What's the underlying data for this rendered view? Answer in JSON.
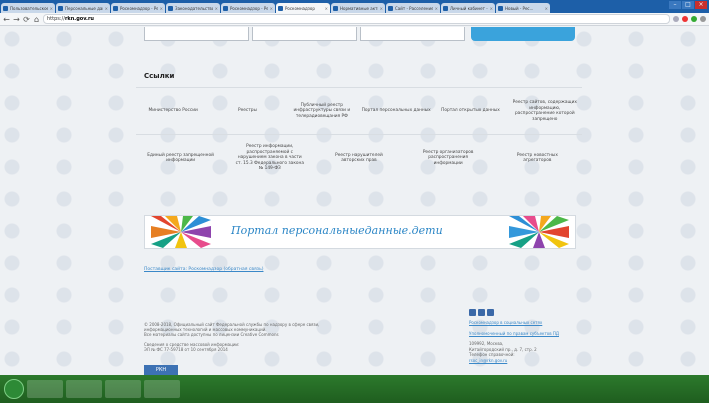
{
  "browser": {
    "tabs": [
      {
        "title": "Пользовательское согл..."
      },
      {
        "title": "Персональные данные..."
      },
      {
        "title": "Роскомнадзор - Реест..."
      },
      {
        "title": "Законодательство - Р..."
      },
      {
        "title": "Роскомнадзор - Ресу..."
      },
      {
        "title": "Роскомнадзор",
        "active": true
      },
      {
        "title": "Нормативные акты - Р..."
      },
      {
        "title": "Сайт - Расселение ..."
      },
      {
        "title": "Личный кабинет - Р..."
      },
      {
        "title": "Новый - Рес..."
      }
    ],
    "address": {
      "scheme": "https://",
      "host": "rkn.gov.ru"
    }
  },
  "page": {
    "section_title": "Ссылки",
    "links_row1": [
      "Министерство России",
      "Реестры",
      "Публичный реестр инфраструктуры связи и телерадиовещания РФ",
      "Портал персональных данных",
      "Портал открытых данных",
      "Реестр сайтов, содержащих информацию, распространение которой запрещено"
    ],
    "links_row2": [
      "Единый реестр запрещенной информации",
      "Реестр информации, распространяемой с нарушением закона в части ст. 15.3 Федерального закона № 149-ФЗ",
      "Реестр нарушителей авторских прав",
      "Реестр организаторов распространения информации",
      "Реестр новостных агрегаторов"
    ],
    "banner_text": "Портал персональныеданные.дети",
    "footer_link": "Поставщик сайта: Роскомнадзор (обратная связь)",
    "footer_left": [
      "© 2008-2018, Официальный сайт Федеральной службы по надзору в сфере связи,",
      "информационных технологий и массовых коммуникаций.",
      "Все материалы сайта доступны по лицензии Creative Commons",
      "",
      "Сведения о средстве массовой информации:",
      "ЭЛ № ФС 77-59718 от 10 сентября 2014"
    ],
    "footer_right_link": "Роскомнадзор в социальных сетях",
    "footer_right_link2": "Уполномоченный по правам субъектов ПД",
    "footer_right": [
      "109992, Москва,",
      "Китайгородский пр., д. 7, стр. 2",
      "Телефон справочной:",
      "rsoc_in@rkn.gov.ru"
    ],
    "bottom_badge": "РКН"
  },
  "taskbar": {
    "clock": ""
  }
}
